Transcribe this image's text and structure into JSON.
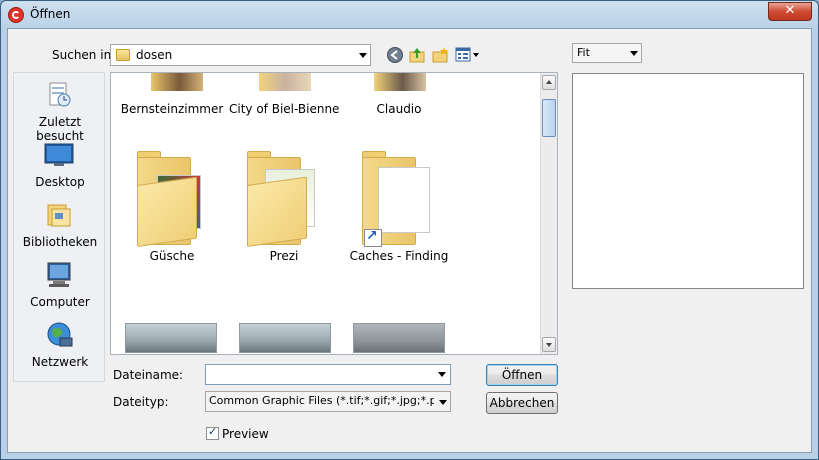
{
  "window": {
    "title": "Öffnen",
    "close_label": "✕"
  },
  "toolbar": {
    "look_in_label": "Suchen in:",
    "look_in_value": "dosen",
    "icons": [
      "back-icon",
      "up-folder-icon",
      "new-folder-icon",
      "view-menu-icon"
    ]
  },
  "places": [
    {
      "label": "Zuletzt besucht",
      "icon": "recent-places-icon"
    },
    {
      "label": "Desktop",
      "icon": "desktop-icon"
    },
    {
      "label": "Bibliotheken",
      "icon": "libraries-icon"
    },
    {
      "label": "Computer",
      "icon": "computer-icon"
    },
    {
      "label": "Netzwerk",
      "icon": "network-icon"
    }
  ],
  "files": {
    "row1": [
      "Bernsteinzimmer",
      "City of Biel-Bienne",
      "Claudio"
    ],
    "row2": [
      "Güsche",
      "Prezi",
      "Caches - Finding"
    ]
  },
  "form": {
    "filename_label": "Dateiname:",
    "filename_value": "",
    "filetype_label": "Dateityp:",
    "filetype_value": "Common Graphic Files (*.tif;*.gif;*.jpg;*.pcx;*.bm",
    "open_button": "Öffnen",
    "cancel_button": "Abbrechen",
    "preview_label": "Preview",
    "preview_checked": true
  },
  "preview": {
    "zoom_value": "Fit"
  }
}
